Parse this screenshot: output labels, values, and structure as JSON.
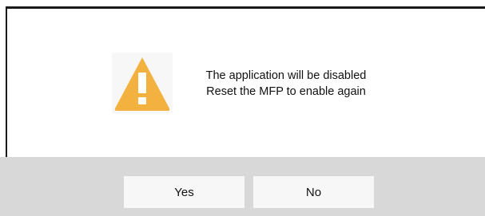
{
  "dialog": {
    "message_line1": "The application will be disabled",
    "message_line2": "Reset the MFP to enable again",
    "icon": "warning-icon",
    "icon_color": "#f3b13f"
  },
  "buttons": {
    "yes_label": "Yes",
    "no_label": "No"
  },
  "colors": {
    "button_bar": "#d8d8d8",
    "button": "#f7f7f7"
  }
}
